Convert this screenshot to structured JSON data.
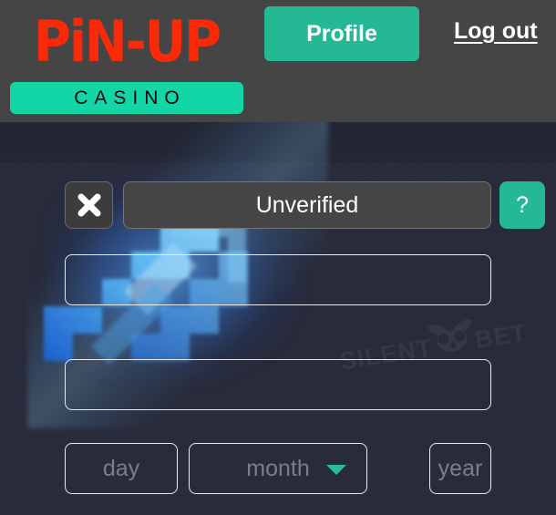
{
  "header": {
    "logo": {
      "wordmark": "PiN-UP",
      "tagline": "CASINO",
      "wordmark_color": "#fa2a08",
      "tagline_bar_color": "#12d6a6"
    },
    "profile_button": "Profile",
    "logout_link": "Log out",
    "background_color": "#454545",
    "accent_color": "#25b894"
  },
  "page": {
    "background_color": "#282b3a"
  },
  "status": {
    "close_icon": "close-x-icon",
    "value": "Unverified",
    "help_label": "?"
  },
  "fields": [
    {
      "name": "field-1",
      "value": "",
      "placeholder": ""
    },
    {
      "name": "field-2",
      "value": "",
      "placeholder": ""
    }
  ],
  "birthdate": {
    "day": "day",
    "month": "month",
    "year": "year",
    "chevron_icon": "chevron-down-icon",
    "chevron_color": "#27bd97"
  },
  "watermark": {
    "text_left": "SILENT",
    "text_right": "BET",
    "logo_icon": "owl-icon",
    "color": "#3e4254"
  },
  "decoration": {
    "graphic_icon": "pixel-arrow-up-right-icon",
    "glow_color": "#388cff"
  }
}
